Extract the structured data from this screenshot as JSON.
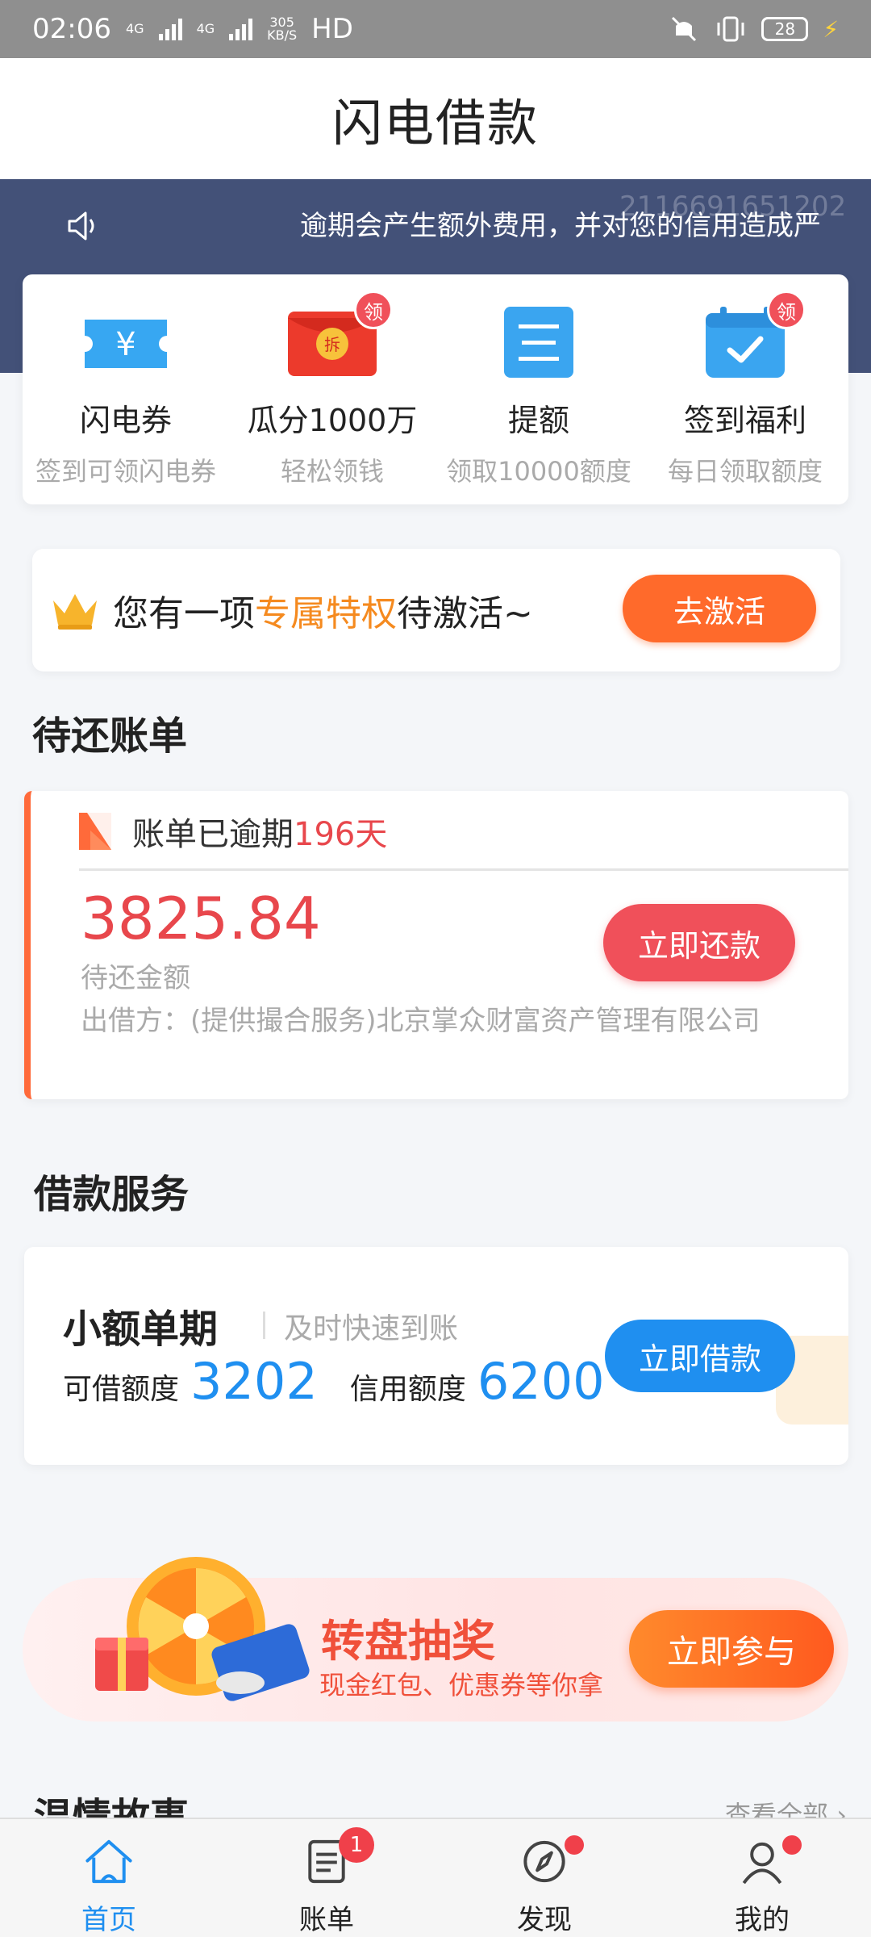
{
  "status_bar": {
    "time": "02:06",
    "net_type_1": "4G",
    "net_type_2": "4G",
    "speed_value": "305",
    "speed_unit": "KB/S",
    "hd": "HD",
    "battery": "28"
  },
  "header": {
    "title": "闪电借款"
  },
  "notice": {
    "text": "逾期会产生额外费用，并对您的信用造成严",
    "id_watermark": "2116691651202"
  },
  "features": [
    {
      "title": "闪电券",
      "sub": "签到可领闪电券",
      "badge": "",
      "icon": "ticket-icon"
    },
    {
      "title": "瓜分1000万",
      "sub": "轻松领钱",
      "badge": "领",
      "icon": "red-envelope-icon"
    },
    {
      "title": "提额",
      "sub": "领取10000额度",
      "badge": "",
      "icon": "document-icon"
    },
    {
      "title": "签到福利",
      "sub": "每日领取额度",
      "badge": "领",
      "icon": "calendar-check-icon"
    }
  ],
  "privilege": {
    "prefix": "您有一项",
    "highlight": "专属特权",
    "suffix": "待激活~",
    "button": "去激活"
  },
  "pending_bills": {
    "section_title": "待还账单",
    "status_prefix": "账单已逾期",
    "overdue_days": "196天",
    "amount": "3825.84",
    "amount_label": "待还金额",
    "lender": "出借方：(提供撮合服务)北京掌众财富资产管理有限公司",
    "button": "立即还款"
  },
  "loan_service": {
    "section_title": "借款服务",
    "product_name": "小额单期",
    "product_tag": "及时快速到账",
    "available_label": "可借额度",
    "available_value": "3202",
    "credit_label": "信用额度",
    "credit_value": "6200",
    "button": "立即借款"
  },
  "lottery": {
    "title": "转盘抽奖",
    "subtitle": "现金红包、优惠券等你拿",
    "button": "立即参与"
  },
  "stories": {
    "title": "温情故事",
    "view_all": "查看全部"
  },
  "tabbar": {
    "tabs": [
      {
        "label": "首页",
        "icon": "home-icon",
        "active": true
      },
      {
        "label": "账单",
        "icon": "bill-icon",
        "badge": "1"
      },
      {
        "label": "发现",
        "icon": "compass-icon",
        "dot": true
      },
      {
        "label": "我的",
        "icon": "profile-icon",
        "dot": true
      }
    ]
  },
  "colors": {
    "accent_blue": "#1f8ff0",
    "notice_bg": "#435178",
    "overdue_red": "#e8474c",
    "highlight_orange": "#f58a1f"
  }
}
